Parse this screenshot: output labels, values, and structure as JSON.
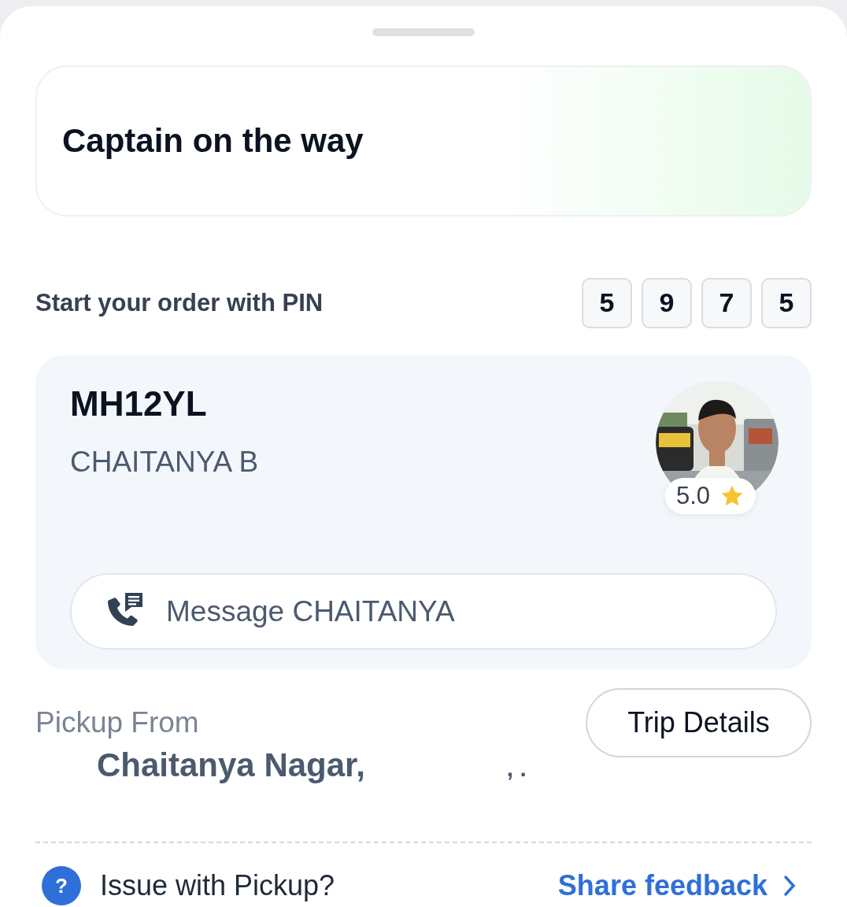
{
  "status_card": {
    "title": "Captain on the way"
  },
  "pin": {
    "label": "Start your order with PIN",
    "digits": [
      "5",
      "9",
      "7",
      "5"
    ]
  },
  "driver": {
    "plate": "MH12YL",
    "name": "CHAITANYA B",
    "rating": "5.0",
    "message_button": "Message CHAITANYA"
  },
  "pickup": {
    "label": "Pickup From",
    "address": "Chaitanya Nagar,",
    "address_tail": ", .",
    "trip_details_button": "Trip Details"
  },
  "issue_row": {
    "icon": "?",
    "text": "Issue with Pickup?",
    "link": "Share feedback"
  }
}
